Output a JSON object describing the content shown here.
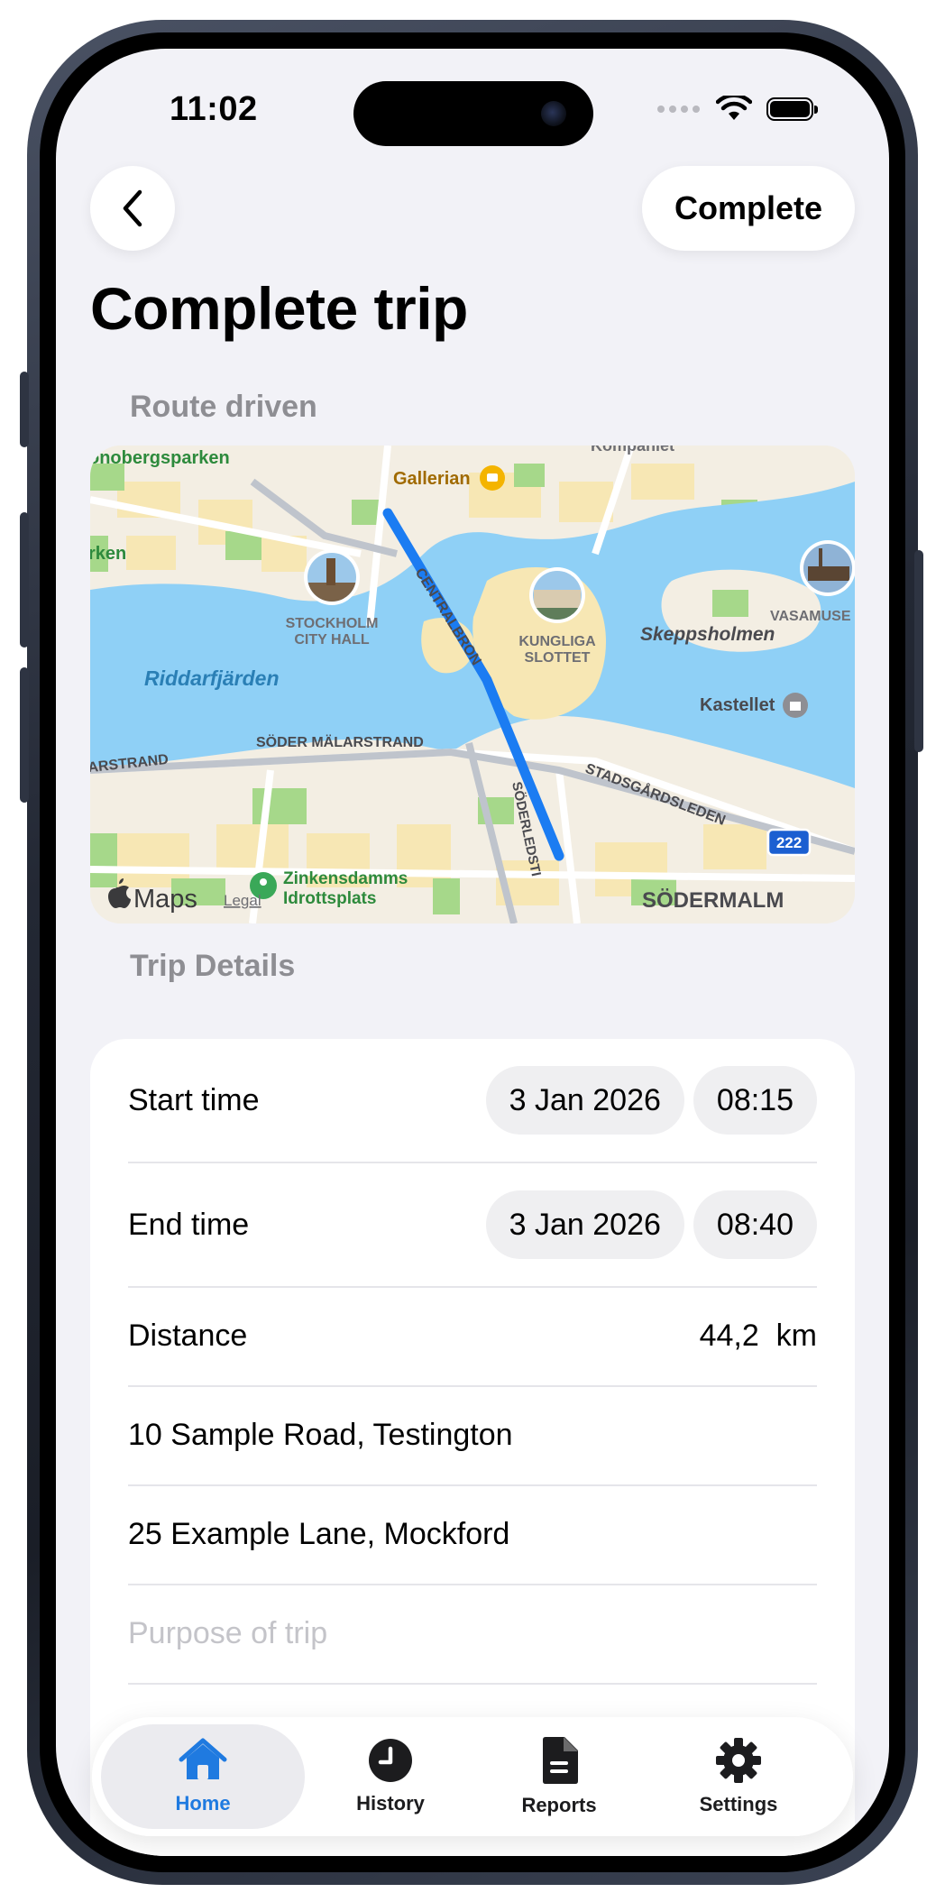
{
  "status_bar": {
    "time": "11:02"
  },
  "header": {
    "back_button_icon": "chevron-left-icon",
    "complete_label": "Complete",
    "title": "Complete trip"
  },
  "route": {
    "section_label": "Route driven",
    "map": {
      "labels": {
        "kronobergsparken": "onobergsparken",
        "kompaniet": "Kompaniet",
        "gallerian": "Gallerian",
        "parken": "rken",
        "stockholm_city_hall": "STOCKHOLM",
        "stockholm_city_hall_2": "CITY HALL",
        "centralbron": "CENTRALBRON",
        "kungliga_slottet": "KUNGLIGA",
        "kungliga_slottet_2": "SLOTTET",
        "skeppsholmen": "Skeppsholmen",
        "vasamuseet": "VASAMUSE",
        "riddarfjarden": "Riddarfjärden",
        "kastellet": "Kastellet",
        "soder_malarstrand": "SÖDER MÄLARSTRAND",
        "arstrand": "ARSTRAND",
        "stadsgardsleden": "STADSGÅRDSLEDEN",
        "route_222": "222",
        "soderledstunneln": "SÖDERLEDSTI",
        "zinkensdamm_1": "Zinkensdamms",
        "zinkensdamm_2": "Idrottsplats",
        "sodermalm": "SÖDERMALM",
        "maps_brand": "Maps",
        "legal": "Legal"
      },
      "colors": {
        "route": "#1b7cf2",
        "water": "#8fd0f6",
        "land": "#f3eee3",
        "park": "#a6d88a"
      }
    }
  },
  "trip_details": {
    "section_label": "Trip Details",
    "start_time": {
      "label": "Start time",
      "date": "3 Jan 2026",
      "time": "08:15"
    },
    "end_time": {
      "label": "End time",
      "date": "3 Jan 2026",
      "time": "08:40"
    },
    "distance": {
      "label": "Distance",
      "value": "44,2  km"
    },
    "start_address": "10 Sample Road, Testington",
    "end_address": "25 Example Lane, Mockford",
    "purpose_placeholder": "Purpose of trip"
  },
  "tab_bar": {
    "accent_color": "#1f7ae0",
    "tabs": [
      {
        "label": "Home",
        "icon": "house-icon",
        "active": true
      },
      {
        "label": "History",
        "icon": "clock-icon",
        "active": false
      },
      {
        "label": "Reports",
        "icon": "document-icon",
        "active": false
      },
      {
        "label": "Settings",
        "icon": "gear-icon",
        "active": false
      }
    ]
  }
}
